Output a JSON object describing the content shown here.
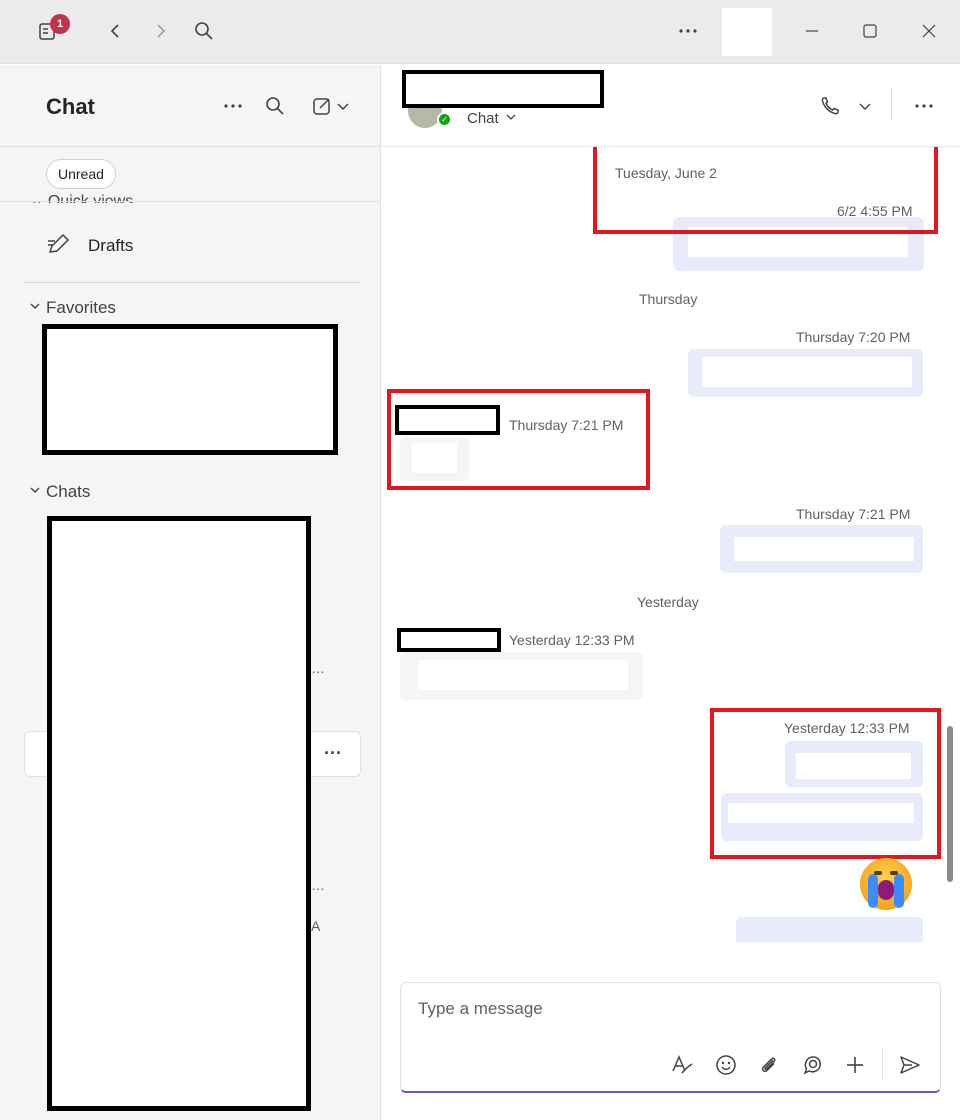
{
  "titlebar": {
    "notification_count": "1"
  },
  "sidebar": {
    "title": "Chat",
    "filter_unread": "Unread",
    "quick_views_label": "Quick views",
    "drafts_label": "Drafts",
    "favorites_label": "Favorites",
    "chats_label": "Chats",
    "fragments": [
      "…",
      "…",
      "A"
    ]
  },
  "chat_header": {
    "tab_label": "Chat"
  },
  "messages": {
    "date_tuesday": "Tuesday, June 2",
    "ts_tuesday": "6/2 4:55 PM",
    "date_thursday": "Thursday",
    "ts_thu_720": "Thursday 7:20 PM",
    "ts_thu_721_other": "Thursday 7:21 PM",
    "ts_thu_721_me": "Thursday 7:21 PM",
    "date_yesterday": "Yesterday",
    "ts_yest_other": "Yesterday 12:33 PM",
    "ts_yest_me": "Yesterday 12:33 PM"
  },
  "compose": {
    "placeholder": "Type a message"
  },
  "colors": {
    "accent": "#5b5fc7",
    "my_bubble": "#e8ebfa",
    "other_bubble": "#f5f5f5",
    "annotation_red": "#e3161b",
    "badge": "#c4314b",
    "presence": "#13a10e"
  },
  "icons": {
    "titlebar": [
      "activity-icon",
      "back-icon",
      "forward-icon",
      "search-icon",
      "more-icon",
      "minimize-icon",
      "maximize-icon",
      "close-icon"
    ],
    "sidebar": [
      "more-icon",
      "search-icon",
      "new-chat-icon",
      "drafts-icon",
      "chevron-down-icon"
    ],
    "header": [
      "call-icon",
      "chevron-down-icon",
      "more-icon"
    ],
    "compose": [
      "format-icon",
      "emoji-icon",
      "attach-icon",
      "loop-icon",
      "plus-icon",
      "send-icon"
    ]
  }
}
